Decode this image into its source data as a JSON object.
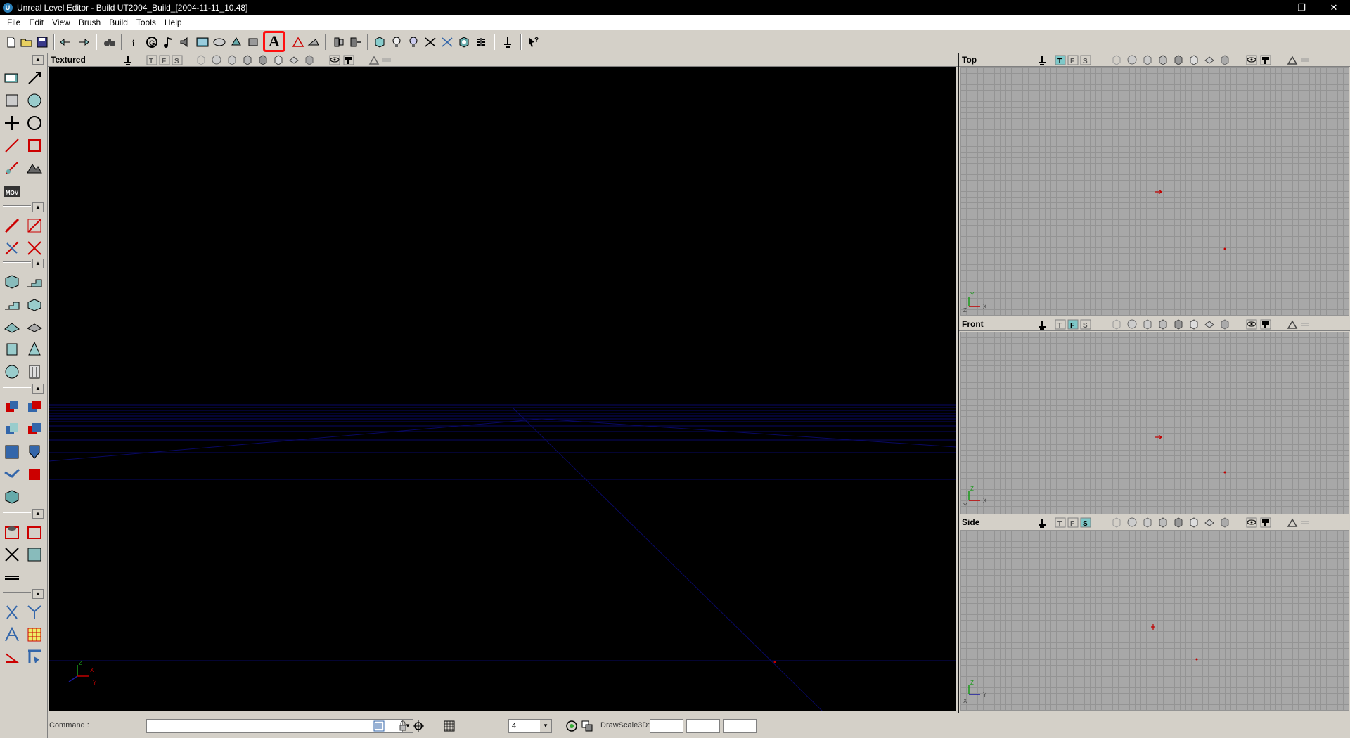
{
  "window": {
    "title": "Unreal Level Editor - Build UT2004_Build_[2004-11-11_10.48]",
    "app_icon_glyph": "U",
    "controls": [
      "–",
      "❐",
      "✕"
    ]
  },
  "menu": [
    "File",
    "Edit",
    "View",
    "Brush",
    "Build",
    "Tools",
    "Help"
  ],
  "toolbar": {
    "actor_button_label": "A",
    "highlight_color": "#ff1010"
  },
  "viewports": {
    "main": {
      "name": "Textured"
    },
    "top": {
      "name": "Top",
      "axis_a": "Y",
      "axis_b": "X",
      "axis_c": "Z"
    },
    "front": {
      "name": "Front",
      "axis_a": "Z",
      "axis_b": "X",
      "axis_c": "Y"
    },
    "side": {
      "name": "Side",
      "axis_a": "Z",
      "axis_b": "Y",
      "axis_c": "X"
    },
    "mode_buttons": [
      "T",
      "F",
      "S"
    ]
  },
  "main_axes": {
    "z": "Z",
    "x": "X",
    "y": "Y"
  },
  "statusbar": {
    "command_label": "Command :",
    "command_value": "",
    "grid_size": "4",
    "drawscale_label": "DrawScale3D:"
  },
  "colors": {
    "chrome": "#d4d0c8",
    "ortho_bg": "#a8a8a8",
    "persp_bg": "#000000",
    "grid_line": "#0a0a6e",
    "actor_marker": "#c00000"
  }
}
